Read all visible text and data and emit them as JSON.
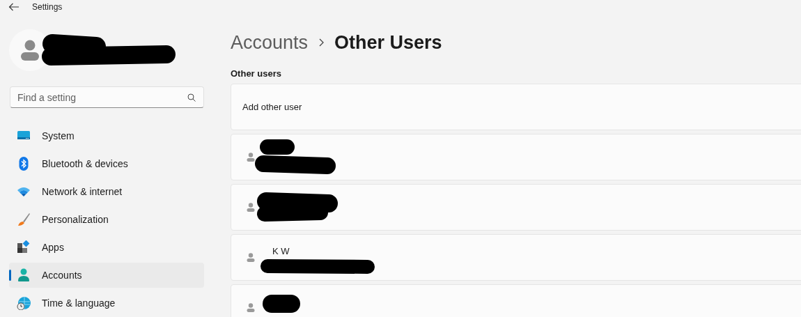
{
  "window": {
    "title": "Settings"
  },
  "sidebar": {
    "search": {
      "placeholder": "Find a setting"
    },
    "items": [
      {
        "label": "System",
        "selected": false
      },
      {
        "label": "Bluetooth & devices",
        "selected": false
      },
      {
        "label": "Network & internet",
        "selected": false
      },
      {
        "label": "Personalization",
        "selected": false
      },
      {
        "label": "Apps",
        "selected": false
      },
      {
        "label": "Accounts",
        "selected": true
      },
      {
        "label": "Time & language",
        "selected": false
      }
    ]
  },
  "breadcrumb": [
    "Accounts",
    "Other Users"
  ],
  "section_title": "Other users",
  "add_user": {
    "label": "Add other user"
  },
  "users": [
    {
      "redacted": true
    },
    {
      "redacted": true
    },
    {
      "name": "K W",
      "redacted": true
    },
    {
      "redacted": true
    }
  ]
}
